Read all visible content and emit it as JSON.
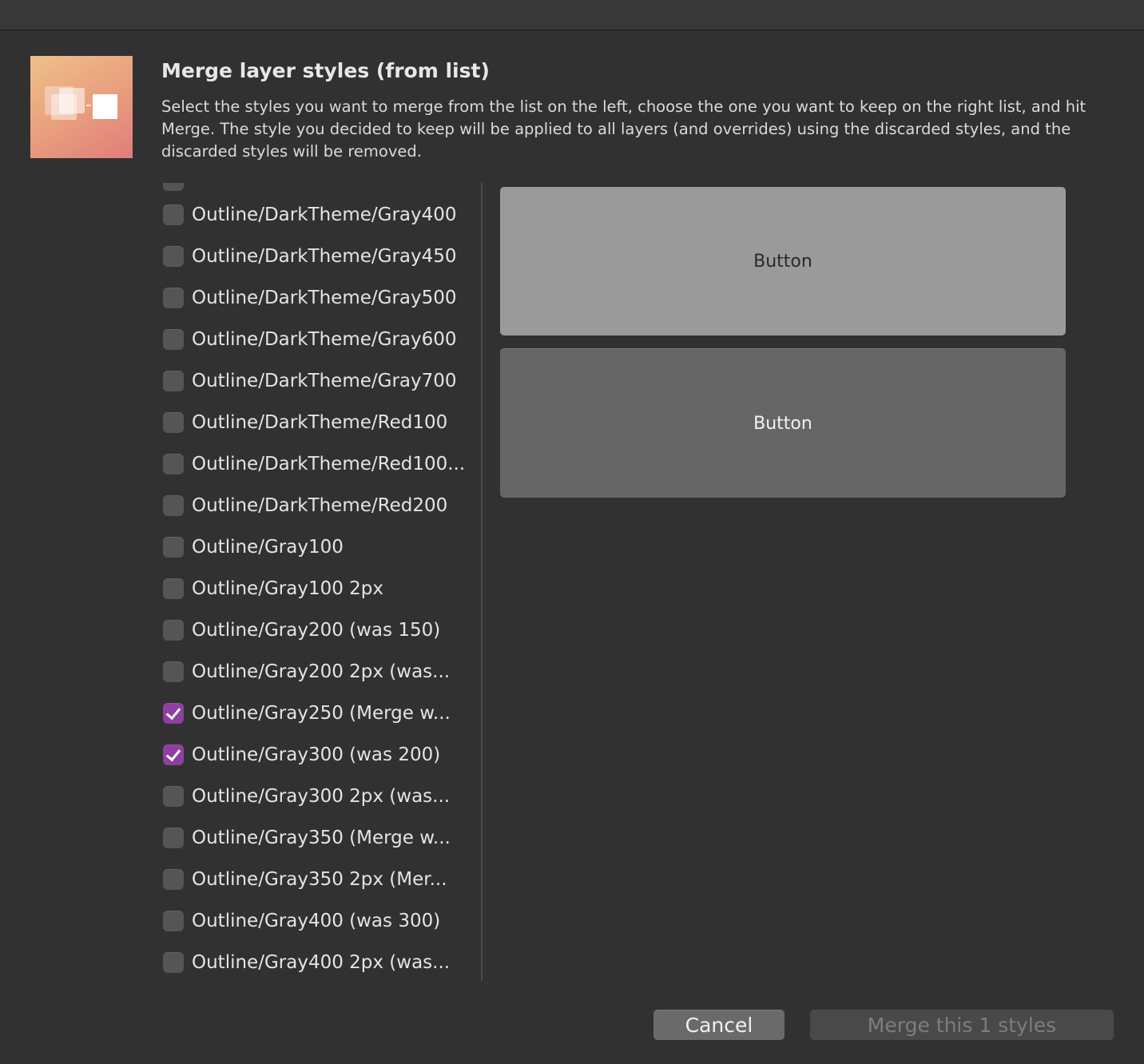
{
  "dialog": {
    "title": "Merge layer styles (from list)",
    "description": "Select the styles you want to merge from the list on the left, choose the one you want to keep on the right list, and hit Merge. The style you decided to keep will be applied to all layers (and overrides) using the discarded styles, and the discarded styles will be removed."
  },
  "style_list": {
    "items": [
      {
        "label": "Outline/DarkTheme/Gray400",
        "checked": false
      },
      {
        "label": "Outline/DarkTheme/Gray450",
        "checked": false
      },
      {
        "label": "Outline/DarkTheme/Gray500",
        "checked": false
      },
      {
        "label": "Outline/DarkTheme/Gray600",
        "checked": false
      },
      {
        "label": "Outline/DarkTheme/Gray700",
        "checked": false
      },
      {
        "label": "Outline/DarkTheme/Red100",
        "checked": false
      },
      {
        "label": "Outline/DarkTheme/Red100...",
        "checked": false
      },
      {
        "label": "Outline/DarkTheme/Red200",
        "checked": false
      },
      {
        "label": "Outline/Gray100",
        "checked": false
      },
      {
        "label": "Outline/Gray100 2px",
        "checked": false
      },
      {
        "label": "Outline/Gray200 (was 150)",
        "checked": false
      },
      {
        "label": "Outline/Gray200 2px (was...",
        "checked": false
      },
      {
        "label": "Outline/Gray250 (Merge w...",
        "checked": true
      },
      {
        "label": "Outline/Gray300 (was 200)",
        "checked": true
      },
      {
        "label": "Outline/Gray300 2px (was...",
        "checked": false
      },
      {
        "label": "Outline/Gray350 (Merge w...",
        "checked": false
      },
      {
        "label": "Outline/Gray350 2px (Mer...",
        "checked": false
      },
      {
        "label": "Outline/Gray400 (was 300)",
        "checked": false
      },
      {
        "label": "Outline/Gray400 2px (was...",
        "checked": false
      }
    ]
  },
  "previews": [
    {
      "label": "Button",
      "bg": "#9a9a9a"
    },
    {
      "label": "Button",
      "bg": "#666666"
    }
  ],
  "buttons": {
    "cancel_label": "Cancel",
    "merge_label": "Merge this 1 styles"
  },
  "colors": {
    "accent_checkbox": "#8e3fa0",
    "window_bg": "#313131"
  }
}
